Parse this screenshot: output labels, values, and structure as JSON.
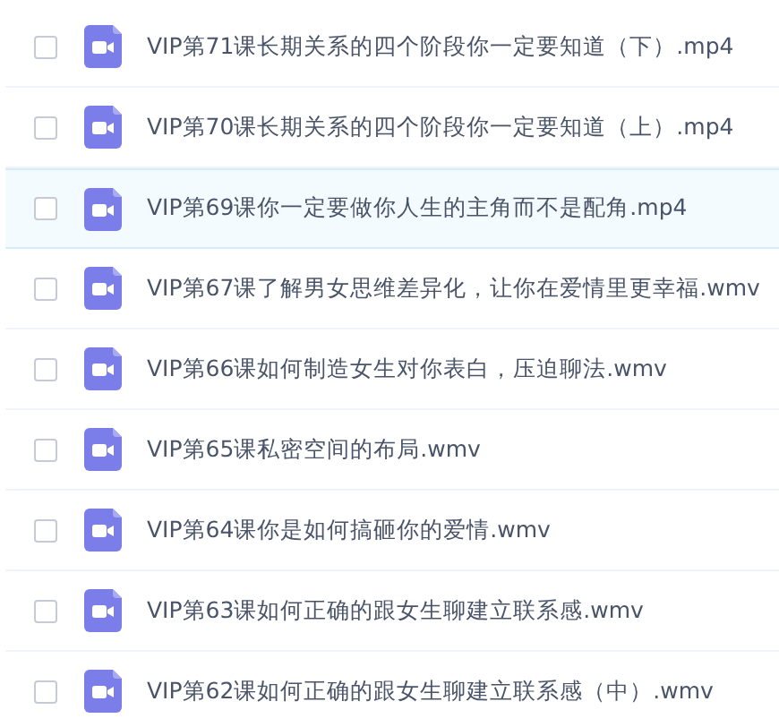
{
  "files": [
    {
      "name": "VIP第71课长期关系的四个阶段你一定要知道（下）.mp4",
      "checked": false,
      "hovered": false
    },
    {
      "name": "VIP第70课长期关系的四个阶段你一定要知道（上）.mp4",
      "checked": false,
      "hovered": false
    },
    {
      "name": "VIP第69课你一定要做你人生的主角而不是配角.mp4",
      "checked": false,
      "hovered": true
    },
    {
      "name": "VIP第67课了解男女思维差异化，让你在爱情里更幸福.wmv",
      "checked": false,
      "hovered": false
    },
    {
      "name": "VIP第66课如何制造女生对你表白，压迫聊法.wmv",
      "checked": false,
      "hovered": false
    },
    {
      "name": "VIP第65课私密空间的布局.wmv",
      "checked": false,
      "hovered": false
    },
    {
      "name": "VIP第64课你是如何搞砸你的爱情.wmv",
      "checked": false,
      "hovered": false
    },
    {
      "name": "VIP第63课如何正确的跟女生聊建立联系感.wmv",
      "checked": false,
      "hovered": false
    },
    {
      "name": "VIP第62课如何正确的跟女生聊建立联系感（中）.wmv",
      "checked": false,
      "hovered": false
    }
  ]
}
